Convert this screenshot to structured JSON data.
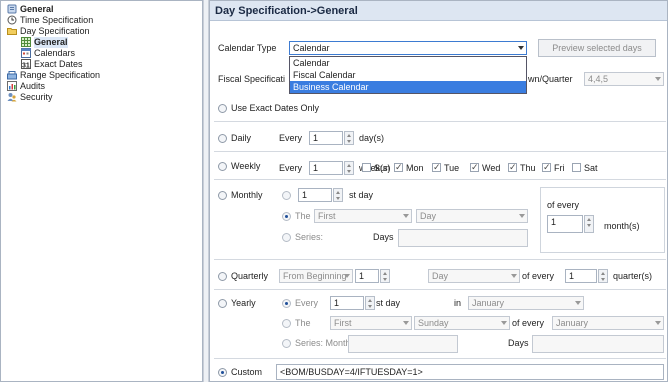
{
  "tree": {
    "items": [
      {
        "label": "General",
        "icon": "general-icon"
      },
      {
        "label": "Time Specification",
        "icon": "clock-icon"
      },
      {
        "label": "Day Specification",
        "icon": "folder-icon"
      },
      {
        "label": "General",
        "icon": "grid-icon"
      },
      {
        "label": "Calendars",
        "icon": "calendar-icon"
      },
      {
        "label": "Exact Dates",
        "icon": "calendar-31-icon"
      },
      {
        "label": "Range Specification",
        "icon": "range-icon"
      },
      {
        "label": "Audits",
        "icon": "audits-icon"
      },
      {
        "label": "Security",
        "icon": "security-icon"
      }
    ]
  },
  "header": {
    "title": "Day Specification->General"
  },
  "calendar_type": {
    "label": "Calendar Type",
    "value": "Calendar",
    "options": [
      "Calendar",
      "Fiscal Calendar",
      "Business Calendar"
    ],
    "highlighted": "Business Calendar",
    "preview_button": "Preview selected days"
  },
  "fiscal": {
    "label_partial": "Fiscal Specificati",
    "breakdown_label": "wn/Quarter",
    "breakdown_value": "4,4,5"
  },
  "exact_dates": {
    "label": "Use Exact Dates Only"
  },
  "daily": {
    "label": "Daily",
    "every": "Every",
    "value": "1",
    "unit": "day(s)"
  },
  "weekly": {
    "label": "Weekly",
    "every": "Every",
    "value": "1",
    "unit": "week(s)",
    "days": [
      {
        "label": "Sun",
        "checked": false
      },
      {
        "label": "Mon",
        "checked": true
      },
      {
        "label": "Tue",
        "checked": true
      },
      {
        "label": "Wed",
        "checked": true
      },
      {
        "label": "Thu",
        "checked": true
      },
      {
        "label": "Fri",
        "checked": true
      },
      {
        "label": "Sat",
        "checked": false
      }
    ]
  },
  "monthly": {
    "label": "Monthly",
    "day_value": "1",
    "day_suffix": "st day",
    "the_label": "The",
    "the_first": "First",
    "the_day": "Day",
    "series_label": "Series:",
    "days_label": "Days",
    "of_every": "of every",
    "months_value": "1",
    "months_unit": "month(s)"
  },
  "quarterly": {
    "label": "Quarterly",
    "from": "From Beginning",
    "value": "1",
    "day": "Day",
    "of_every": "of every",
    "qvalue": "1",
    "unit": "quarter(s)"
  },
  "yearly": {
    "label": "Yearly",
    "every_label": "Every",
    "value": "1",
    "suffix": "st day",
    "in_label": "in",
    "month": "January",
    "the_label": "The",
    "the_first": "First",
    "the_day": "Sunday",
    "of_every": "of every",
    "the_month": "January",
    "series_label": "Series: Months",
    "days_label": "Days"
  },
  "custom": {
    "label": "Custom",
    "value": "<BOM/BUSDAY=4/IFTUESDAY=1>"
  }
}
